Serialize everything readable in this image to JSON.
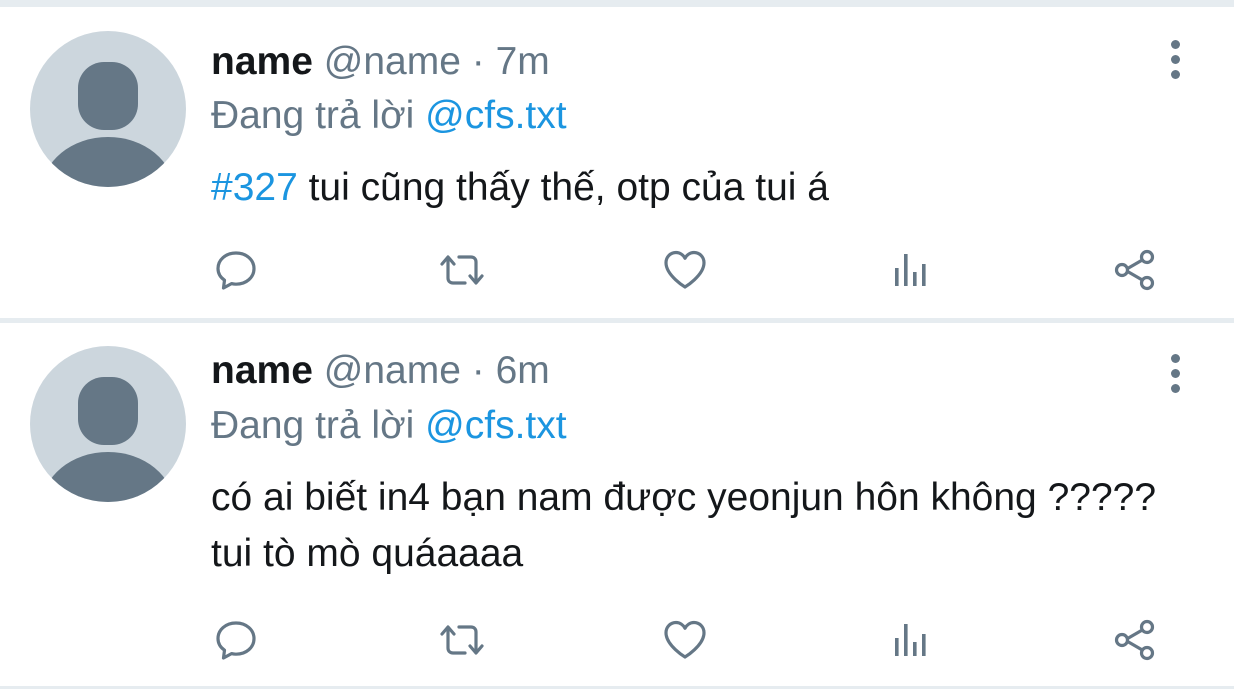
{
  "colors": {
    "background": "#e6ecf0",
    "card": "#ffffff",
    "text_primary": "#14171a",
    "text_secondary": "#657786",
    "accent_link": "#1b95e0",
    "avatar_bg": "#ccd6dd",
    "avatar_silhouette": "#657786"
  },
  "tweets": [
    {
      "display_name": "name",
      "handle": "@name",
      "separator": "·",
      "time": "7m",
      "reply_prefix": "Đang trả lời",
      "reply_to": "@cfs.txt",
      "hashtag": "#327",
      "text": " tui cũng thấy thế, otp của tui á",
      "actions": {
        "reply_icon": "reply-icon",
        "retweet_icon": "retweet-icon",
        "like_icon": "heart-icon",
        "stats_icon": "analytics-icon",
        "share_icon": "share-icon"
      }
    },
    {
      "display_name": "name",
      "handle": "@name",
      "separator": "·",
      "time": "6m",
      "reply_prefix": "Đang trả lời",
      "reply_to": "@cfs.txt",
      "hashtag": "",
      "text": "có ai biết in4 bạn nam được yeonjun hôn không ????? tui tò mò quáaaaa",
      "actions": {
        "reply_icon": "reply-icon",
        "retweet_icon": "retweet-icon",
        "like_icon": "heart-icon",
        "stats_icon": "analytics-icon",
        "share_icon": "share-icon"
      }
    }
  ]
}
